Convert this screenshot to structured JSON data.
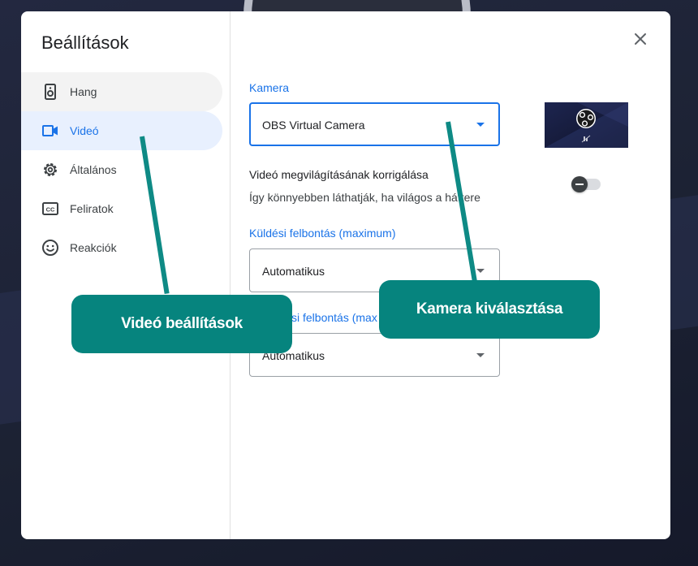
{
  "dialog": {
    "title": "Beállítások",
    "close_icon": "close-icon"
  },
  "sidebar": {
    "items": [
      {
        "label": "Hang",
        "icon": "speaker-icon",
        "state": "hover"
      },
      {
        "label": "Videó",
        "icon": "videocam-icon",
        "state": "active"
      },
      {
        "label": "Általános",
        "icon": "gear-icon",
        "state": "normal"
      },
      {
        "label": "Feliratok",
        "icon": "closed-captions-icon",
        "state": "normal"
      },
      {
        "label": "Reakciók",
        "icon": "smiley-icon",
        "state": "normal"
      }
    ]
  },
  "video": {
    "camera": {
      "label": "Kamera",
      "value": "OBS Virtual Camera"
    },
    "lighting": {
      "title": "Videó megvilágításának korrigálása",
      "description": "Így könnyebben láthatják, ha világos a háttere",
      "enabled": false
    },
    "send_resolution": {
      "label": "Küldési felbontás (maximum)",
      "value": "Automatikus"
    },
    "receive_resolution": {
      "label": "Fogadási felbontás (maximum)",
      "label_visible": "si felbontás (max",
      "value": "Automatikus"
    }
  },
  "callouts": {
    "video_settings": "Videó beállítások",
    "camera_select": "Kamera kiválasztása"
  },
  "colors": {
    "accent": "#1a73e8",
    "callout": "#06847e",
    "active_bg": "#e8f0fe"
  }
}
